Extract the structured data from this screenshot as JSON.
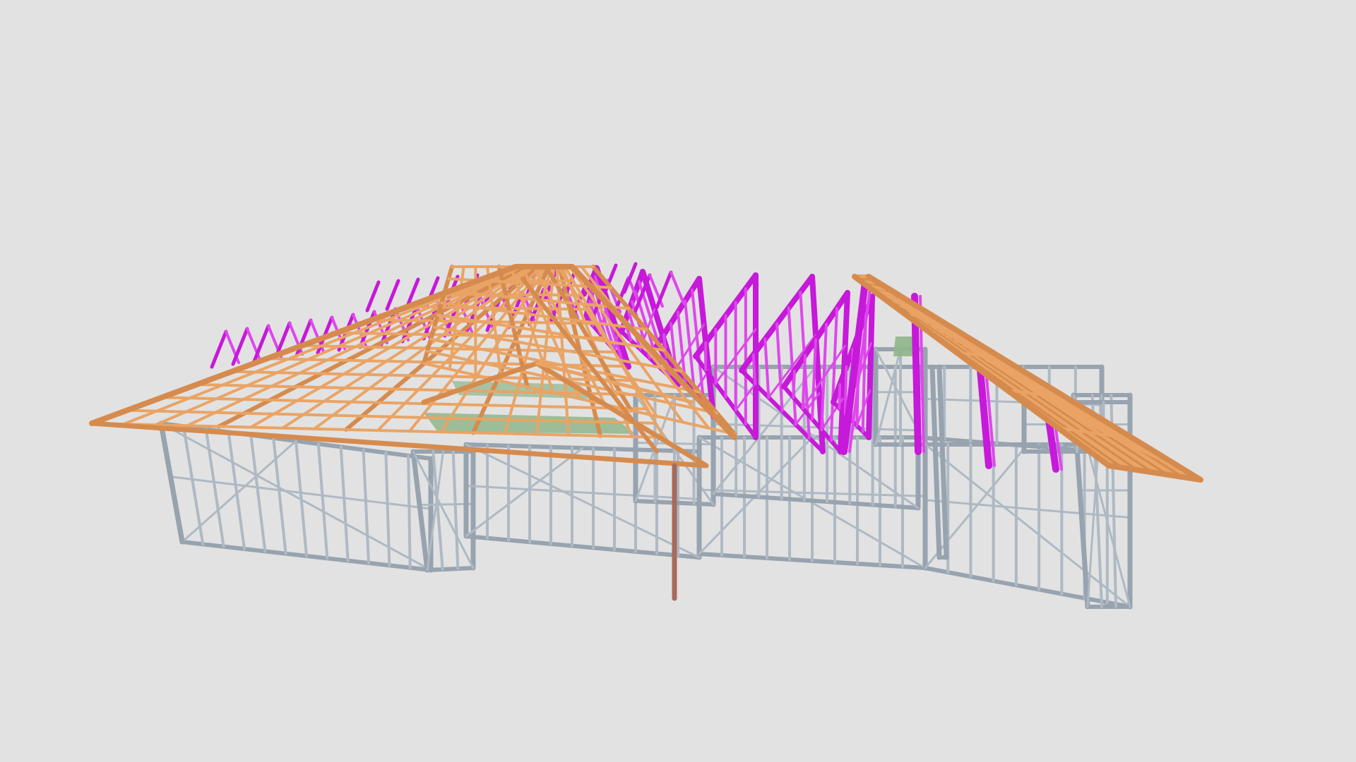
{
  "viewer": {
    "background": "#e2e2e2",
    "model": "steel-frame-house"
  },
  "materials": {
    "wall_frame": "#aeb9c4",
    "wall_frame_dark": "#97a3af",
    "roof_battens": "#e9a465",
    "roof_battens_dark": "#d68b4e",
    "trusses": "#c619d9",
    "trusses_light": "#de47ec",
    "ceiling_panels": "#8fb68b",
    "post": "#a86a5c"
  }
}
